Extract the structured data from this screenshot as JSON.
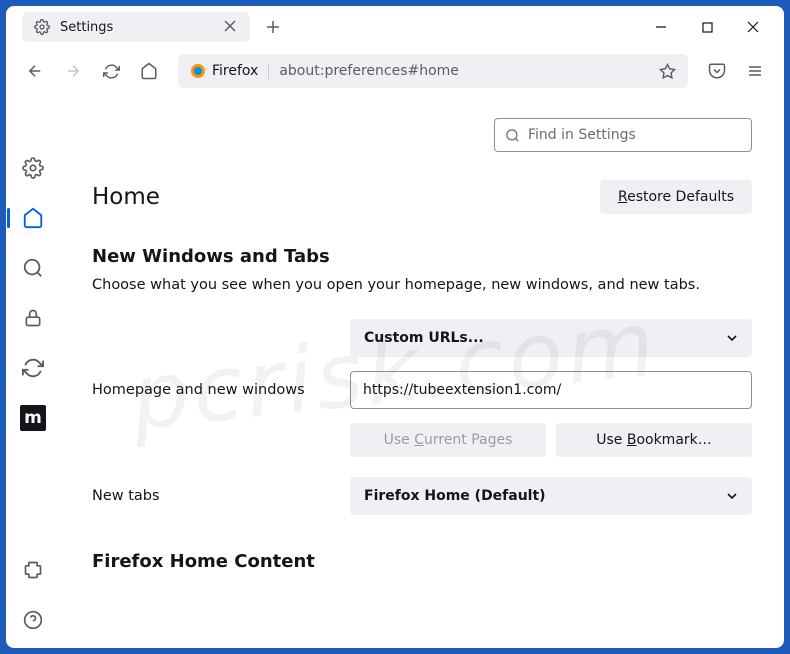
{
  "window": {
    "tab_title": "Settings"
  },
  "urlbar": {
    "identity": "Firefox",
    "url": "about:preferences#home"
  },
  "search": {
    "placeholder": "Find in Settings"
  },
  "header": {
    "title": "Home",
    "restore_btn": "Restore Defaults"
  },
  "section": {
    "title": "New Windows and Tabs",
    "description": "Choose what you see when you open your homepage, new windows, and new tabs."
  },
  "homepage": {
    "label": "Homepage and new windows",
    "select_value": "Custom URLs...",
    "url_value": "https://tubeextension1.com/",
    "use_current": "Use Current Pages",
    "use_bookmark": "Use Bookmark…"
  },
  "newtabs": {
    "label": "New tabs",
    "select_value": "Firefox Home (Default)"
  },
  "section2": {
    "title": "Firefox Home Content"
  },
  "watermark": "pcrisk.com"
}
